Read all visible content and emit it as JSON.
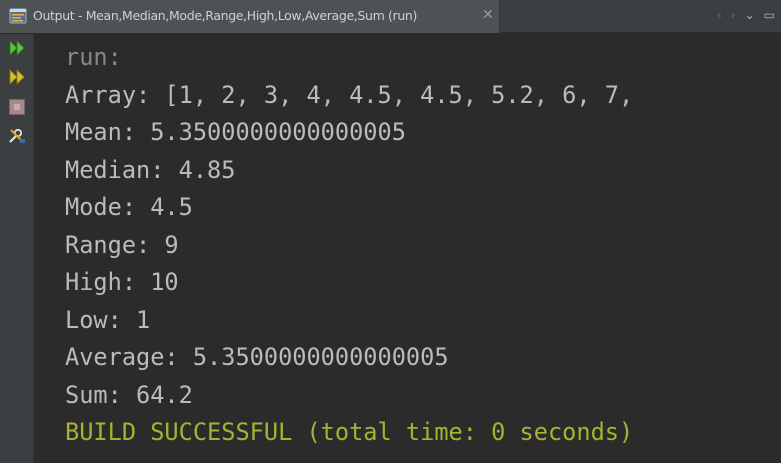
{
  "window": {
    "tab_title": "Output - Mean,Median,Mode,Range,High,Low,Average,Sum (run)",
    "tab_close": "✕",
    "controls": {
      "prev": "‹",
      "next": "›",
      "menu": "⌄",
      "minimize": "▭"
    }
  },
  "toolbar": {
    "tools": [
      {
        "name": "rerun",
        "icon": "double-arrow-green-icon"
      },
      {
        "name": "rerun-with-changes",
        "icon": "double-arrow-yellow-icon"
      },
      {
        "name": "stop",
        "icon": "stop-square-icon"
      },
      {
        "name": "settings",
        "icon": "wrench-screwdriver-icon"
      }
    ]
  },
  "console": {
    "lines": [
      {
        "text": "run:",
        "kind": "muted"
      },
      {
        "text": "Array: [1, 2, 3, 4, 4.5, 4.5, 5.2, 6, 7,",
        "kind": "normal"
      },
      {
        "text": "Mean: 5.3500000000000005",
        "kind": "normal"
      },
      {
        "text": "Median: 4.85",
        "kind": "normal"
      },
      {
        "text": "Mode: 4.5",
        "kind": "normal"
      },
      {
        "text": "Range: 9",
        "kind": "normal"
      },
      {
        "text": "High: 10",
        "kind": "normal"
      },
      {
        "text": "Low: 1",
        "kind": "normal"
      },
      {
        "text": "Average: 5.3500000000000005",
        "kind": "normal"
      },
      {
        "text": "Sum: 64.2",
        "kind": "normal"
      },
      {
        "text": "BUILD SUCCESSFUL (total time: 0 seconds)",
        "kind": "success"
      }
    ]
  },
  "colors": {
    "background": "#2b2b2b",
    "panel": "#3c3f41",
    "text": "#bbbbbb",
    "muted": "#888888",
    "success": "#a8b230"
  }
}
